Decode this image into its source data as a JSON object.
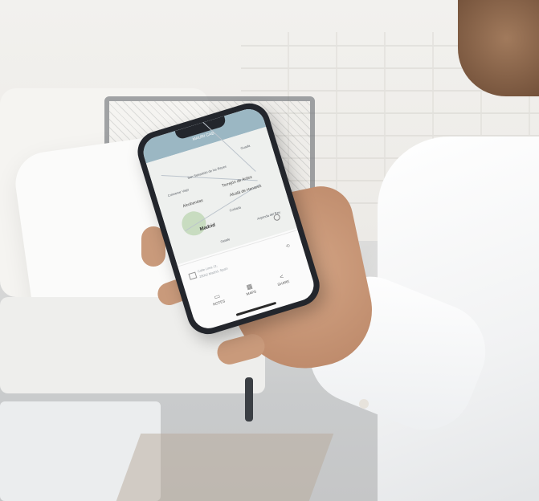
{
  "scene": {
    "description_label": "Person holding smartphone with map app"
  },
  "app": {
    "title": "MAURI CAB",
    "map": {
      "labels": {
        "guadalajara": "Guada",
        "torrejon": "Torrejón de Ardoz",
        "alcobendas": "Alcobendas",
        "alcala": "Alcalá de Henares",
        "madrid": "Madrid",
        "coslada": "Coslada",
        "arganda": "Arganda del Rey",
        "getafe": "Getafe",
        "san_sebastian": "San Sebastián de los Reyes",
        "colmenar": "Colmenar Viejo"
      }
    },
    "address": {
      "line1": "Calle Lima 12,",
      "line2": "28002 Madrid, Spain"
    },
    "toolbar": {
      "notes": "NOTES",
      "maps": "MAPS",
      "share": "SHARE"
    }
  }
}
